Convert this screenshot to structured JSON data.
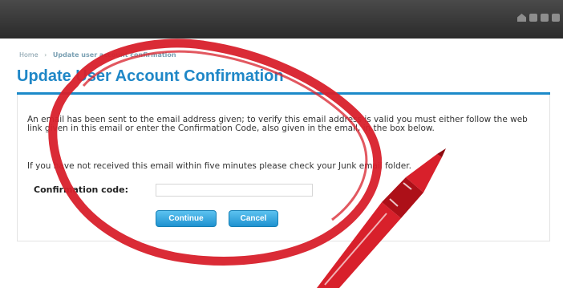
{
  "window": {
    "toolbar_icons": [
      "home-icon",
      "square-icon",
      "square-icon",
      "square-icon"
    ]
  },
  "breadcrumb": {
    "home": "Home",
    "separator": "›",
    "current": "Update user account confirmation"
  },
  "page": {
    "title": "Update User Account Confirmation"
  },
  "form": {
    "message": "An email has been sent to the email address given; to verify this email address is valid you must either follow the web link given in this email or enter the Confirmation Code, also given in the email, in the box below.",
    "junk_notice": "If you have not received this email within five minutes please check your Junk email folder.",
    "code_label": "Confirmation code:",
    "code_value": "",
    "continue_label": "Continue",
    "cancel_label": "Cancel"
  },
  "colors": {
    "accent": "#1f87c7",
    "button": "#2a9ad6",
    "topbar": "#333333",
    "marker": "#d8202b"
  },
  "annotation": {
    "icon": "red-marker-pen-icon"
  }
}
